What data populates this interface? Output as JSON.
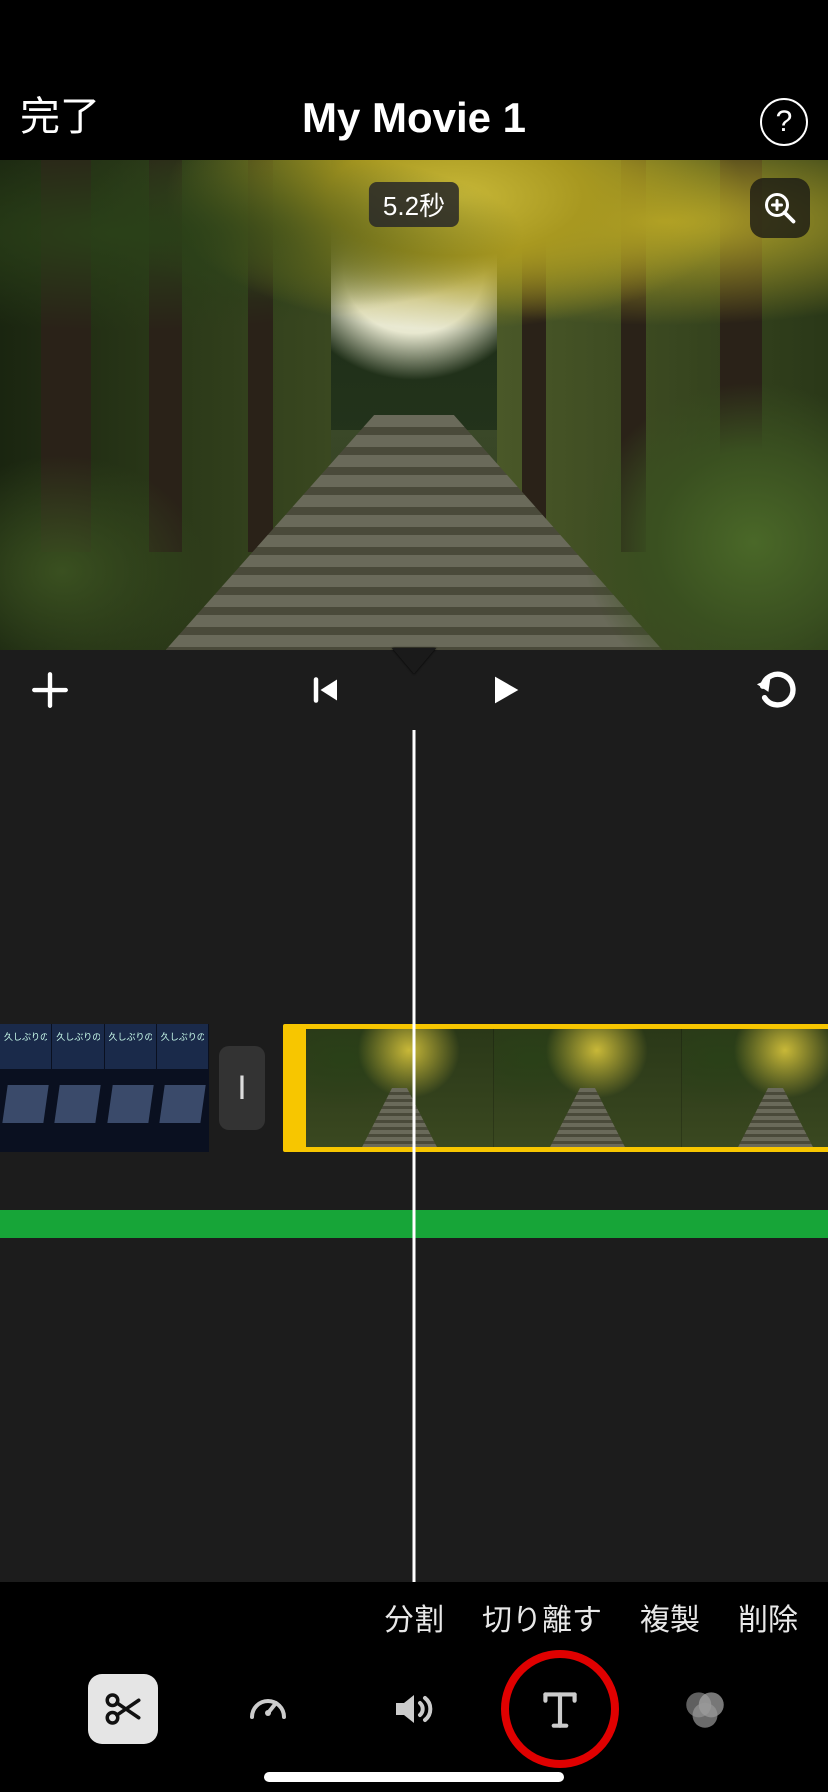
{
  "header": {
    "done_label": "完了",
    "title": "My Movie 1",
    "help_label": "?"
  },
  "preview": {
    "duration_badge": "5.2秒"
  },
  "timeline": {
    "prev_clip_caption": "久しぶりの国内旅行",
    "transition_glyph": "I"
  },
  "actions": {
    "split": "分割",
    "detach": "切り離す",
    "duplicate": "複製",
    "delete": "削除"
  },
  "tools": {
    "scissors": "cut",
    "speed": "speed",
    "volume": "volume",
    "text": "T",
    "filter": "filter"
  }
}
